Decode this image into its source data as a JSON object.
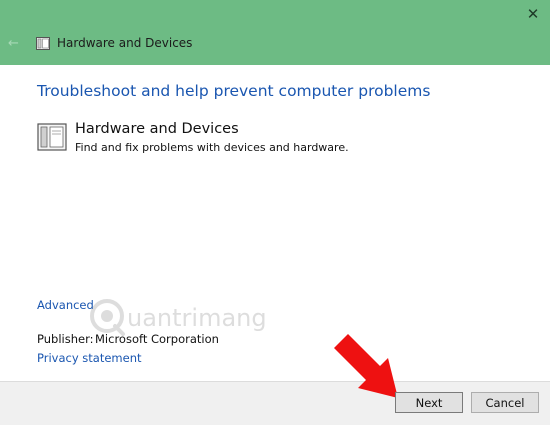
{
  "window": {
    "title": "Hardware and Devices",
    "close_glyph": "✕",
    "back_glyph": "←",
    "titlebar_color": "#6dbb84"
  },
  "main": {
    "heading": "Troubleshoot and help prevent computer problems",
    "item": {
      "title": "Hardware and Devices",
      "description": "Find and fix problems with devices and hardware.",
      "icon": "hardware-devices-icon"
    },
    "advanced_link": "Advanced",
    "publisher_label": "Publisher:",
    "publisher_value": "Microsoft Corporation",
    "privacy_link": "Privacy statement"
  },
  "watermark": {
    "text": "uantrimang"
  },
  "footer": {
    "next_label": "Next",
    "cancel_label": "Cancel"
  },
  "colors": {
    "link": "#1a56b0",
    "arrow": "#ee1111"
  }
}
